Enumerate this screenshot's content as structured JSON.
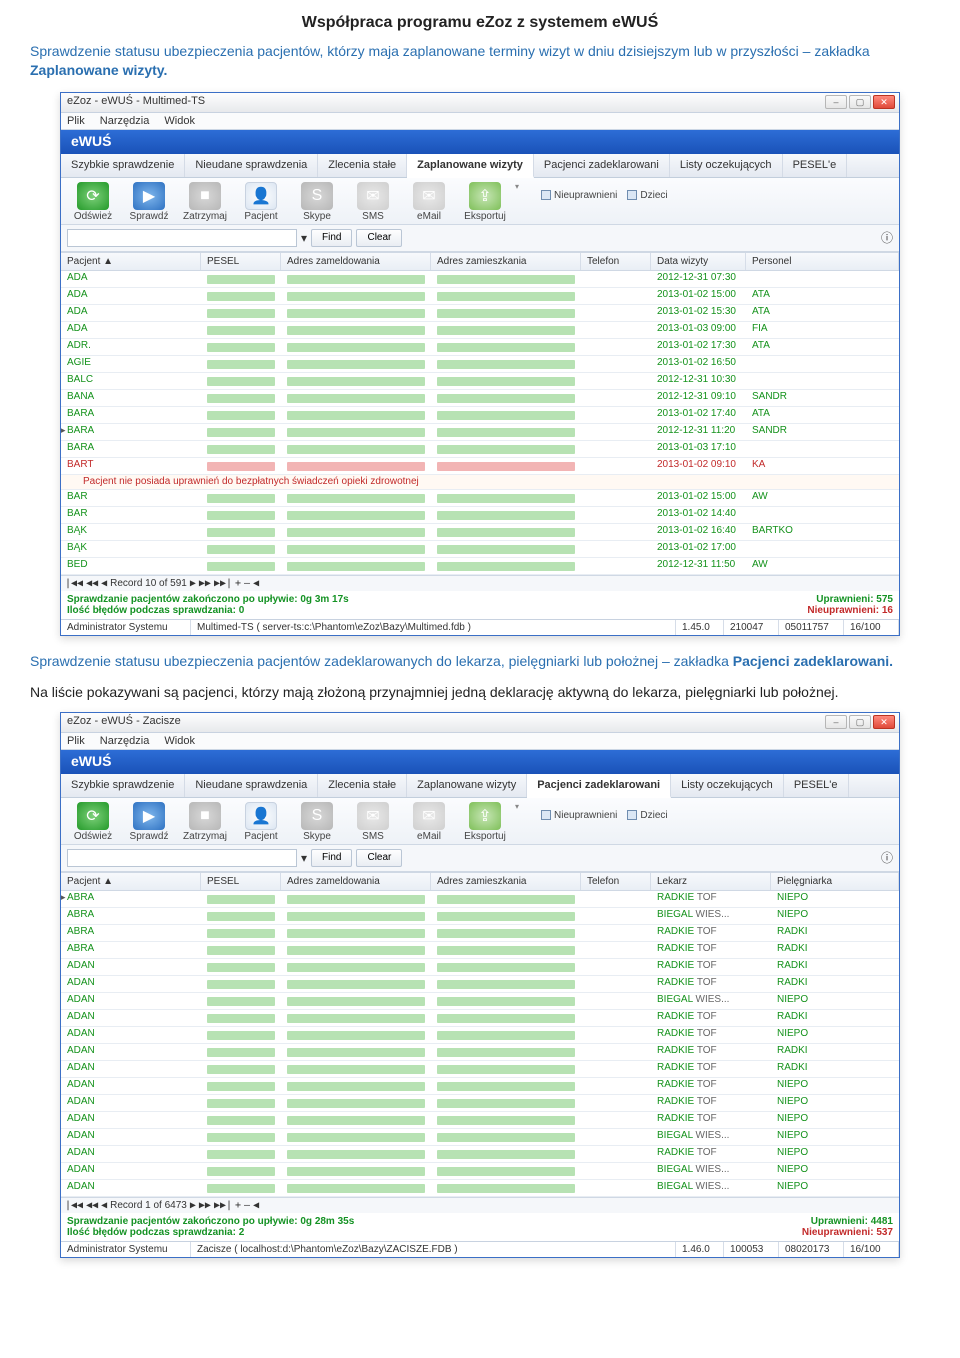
{
  "page_title": "Współpraca programu eZoz z systemem eWUŚ",
  "intro1_a": "Sprawdzenie statusu ubezpieczenia pacjentów, którzy maja zaplanowane terminy wizyt w dniu dzisiejszym lub w przyszłości – zakładka ",
  "intro1_b": "Zaplanowane wizyty.",
  "intro2_a": "Sprawdzenie statusu ubezpieczenia pacjentów zadeklarowanych do lekarza, pielęgniarki lub położnej – zakładka ",
  "intro2_b": "Pacjenci zadeklarowani.",
  "body2": "Na liście pokazywani są pacjenci, którzy mają złożoną przynajmniej jedną deklarację aktywną do lekarza, pielęgniarki lub położnej.",
  "menus": {
    "plik": "Plik",
    "narzedzia": "Narzędzia",
    "widok": "Widok"
  },
  "win_ctrls": {
    "min": "–",
    "max": "▢",
    "close": "✕"
  },
  "band": "eWUŚ",
  "tabs": {
    "szybkie": "Szybkie sprawdzenie",
    "nieudane": "Nieudane sprawdzenia",
    "zlecenia": "Zlecenia stałe",
    "zaplanowane": "Zaplanowane wizyty",
    "zadeklarowani": "Pacjenci zadeklarowani",
    "listy": "Listy oczekujących",
    "pesel": "PESEL'e"
  },
  "tools": {
    "odswiez": "Odśwież",
    "sprawdz": "Sprawdź",
    "zatrzymaj": "Zatrzymaj",
    "pacjent": "Pacjent",
    "skype": "Skype",
    "sms": "SMS",
    "email": "eMail",
    "eksportuj": "Eksportuj"
  },
  "side": {
    "nieupr": "Nieuprawnieni",
    "dzieci": "Dzieci",
    "drop": "▾"
  },
  "filter": {
    "find": "Find",
    "clear": "Clear",
    "drop": "▾",
    "info": "ⓘ"
  },
  "winA": {
    "title": "eZoz - eWUŚ - Multimed-TS",
    "headers": {
      "pacjent": "Pacjent",
      "pesel": "PESEL",
      "adrm": "Adres zameldowania",
      "adrz": "Adres zamieszkania",
      "tel": "Telefon",
      "data": "Data wizyty",
      "pers": "Personel",
      "sort": "▲"
    },
    "warn": "Pacjent nie posiada uprawnień do bezpłatnych świadczeń opieki zdrowotnej",
    "rows": [
      {
        "n": "ADA",
        "d": "2012-12-31 07:30",
        "p": "",
        "s": "g"
      },
      {
        "n": "ADA",
        "d": "2013-01-02 15:00",
        "p": "ATA",
        "s": "g"
      },
      {
        "n": "ADA",
        "d": "2013-01-02 15:30",
        "p": "ATA",
        "s": "g"
      },
      {
        "n": "ADA",
        "d": "2013-01-03 09:00",
        "p": "FIA",
        "s": "g"
      },
      {
        "n": "ADR.",
        "d": "2013-01-02 17:30",
        "p": "ATA",
        "s": "g"
      },
      {
        "n": "AGIE",
        "d": "2013-01-02 16:50",
        "p": "",
        "s": "g"
      },
      {
        "n": "BALC",
        "d": "2012-12-31 10:30",
        "p": "",
        "s": "g"
      },
      {
        "n": "BANA",
        "d": "2012-12-31 09:10",
        "p": "SANDR",
        "s": "g"
      },
      {
        "n": "BARA",
        "d": "2013-01-02 17:40",
        "p": "ATA",
        "s": "g"
      },
      {
        "n": "BARA",
        "d": "2012-12-31 11:20",
        "p": "SANDR",
        "s": "g",
        "sel": true
      },
      {
        "n": "BARA",
        "d": "2013-01-03 17:10",
        "p": "",
        "s": "g"
      },
      {
        "n": "BART",
        "d": "2013-01-02 09:10",
        "p": "KA",
        "s": "r",
        "warn": true
      },
      {
        "n": "BAR",
        "d": "2013-01-02 15:00",
        "p": "AW",
        "s": "g"
      },
      {
        "n": "BAR",
        "d": "2013-01-02 14:40",
        "p": "",
        "s": "g"
      },
      {
        "n": "BĄK",
        "d": "2013-01-02 16:40",
        "p": "BARTKO",
        "s": "g"
      },
      {
        "n": "BĄK",
        "d": "2013-01-02 17:00",
        "p": "",
        "s": "g"
      },
      {
        "n": "BED",
        "d": "2012-12-31 11:50",
        "p": "AW",
        "s": "g"
      }
    ],
    "pager": {
      "first": "|◀◀",
      "prev2": "◀◀",
      "prev": "◀",
      "rec": "Record 10 of 591",
      "next": "▶",
      "next2": "▶▶",
      "last": "▶▶|",
      "add": "+",
      "del": "–",
      "edit": "◀"
    },
    "stats": {
      "ok": "Sprawdzanie pacjentów zakończono po upływie: 0g 3m 17s",
      "err": "Ilość błędów podczas sprawdzania: 0",
      "up": "Uprawnieni: 575",
      "nup": "Nieuprawnieni: 16"
    },
    "status": {
      "admin": "Administrator Systemu",
      "db": "Multimed-TS ( server-ts:c:\\Phantom\\eZoz\\Bazy\\Multimed.fdb )",
      "ver": "1.45.0",
      "a": "210047",
      "b": "05011757",
      "c": "16/100"
    }
  },
  "winB": {
    "title": "eZoz - eWUŚ - Zacisze",
    "headers": {
      "pacjent": "Pacjent",
      "pesel": "PESEL",
      "adrm": "Adres zameldowania",
      "adrz": "Adres zamieszkania",
      "tel": "Telefon",
      "lek": "Lekarz",
      "piel": "Pielęgniarka",
      "sort": "▲"
    },
    "rows": [
      {
        "n": "ABRA",
        "l": "RADKIE",
        "lp": "TOF",
        "p": "NIEPO",
        "s": "g",
        "sel": true
      },
      {
        "n": "ABRA",
        "l": "BIEGAL",
        "lp": "WIES...",
        "p": "NIEPO",
        "s": "g"
      },
      {
        "n": "ABRA",
        "l": "RADKIE",
        "lp": "TOF",
        "p": "RADKI",
        "s": "g"
      },
      {
        "n": "ABRA",
        "l": "RADKIE",
        "lp": "TOF",
        "p": "RADKI",
        "s": "g"
      },
      {
        "n": "ADAN",
        "l": "RADKIE",
        "lp": "TOF",
        "p": "RADKI",
        "s": "g"
      },
      {
        "n": "ADAN",
        "l": "RADKIE",
        "lp": "TOF",
        "p": "RADKI",
        "s": "g"
      },
      {
        "n": "ADAN",
        "l": "BIEGAL",
        "lp": "WIES...",
        "p": "NIEPO",
        "s": "g"
      },
      {
        "n": "ADAN",
        "l": "RADKIE",
        "lp": "TOF",
        "p": "RADKI",
        "s": "g"
      },
      {
        "n": "ADAN",
        "l": "RADKIE",
        "lp": "TOF",
        "p": "NIEPO",
        "s": "g"
      },
      {
        "n": "ADAN",
        "l": "RADKIE",
        "lp": "TOF",
        "p": "RADKI",
        "s": "g"
      },
      {
        "n": "ADAN",
        "l": "RADKIE",
        "lp": "TOF",
        "p": "RADKI",
        "s": "g"
      },
      {
        "n": "ADAN",
        "l": "RADKIE",
        "lp": "TOF",
        "p": "NIEPO",
        "s": "g"
      },
      {
        "n": "ADAN",
        "l": "RADKIE",
        "lp": "TOF",
        "p": "NIEPO",
        "s": "g"
      },
      {
        "n": "ADAN",
        "l": "RADKIE",
        "lp": "TOF",
        "p": "NIEPO",
        "s": "g"
      },
      {
        "n": "ADAN",
        "l": "BIEGAL",
        "lp": "WIES...",
        "p": "NIEPO",
        "s": "g"
      },
      {
        "n": "ADAN",
        "l": "RADKIE",
        "lp": "TOF",
        "p": "NIEPO",
        "s": "g"
      },
      {
        "n": "ADAN",
        "l": "BIEGAL",
        "lp": "WIES...",
        "p": "NIEPO",
        "s": "g"
      },
      {
        "n": "ADAN",
        "l": "BIEGAL",
        "lp": "WIES...",
        "p": "NIEPO",
        "s": "g"
      }
    ],
    "pager": {
      "first": "|◀◀",
      "prev2": "◀◀",
      "prev": "◀",
      "rec": "Record 1 of 6473",
      "next": "▶",
      "next2": "▶▶",
      "last": "▶▶|",
      "add": "+",
      "del": "–",
      "edit": "◀"
    },
    "stats": {
      "ok": "Sprawdzanie pacjentów zakończono po upływie: 0g 28m 35s",
      "err": "Ilość błędów podczas sprawdzania: 2",
      "up": "Uprawnieni: 4481",
      "nup": "Nieuprawnieni: 537"
    },
    "status": {
      "admin": "Administrator Systemu",
      "db": "Zacisze ( localhost:d:\\Phantom\\eZoz\\Bazy\\ZACISZE.FDB )",
      "ver": "1.46.0",
      "a": "100053",
      "b": "08020173",
      "c": "16/100"
    }
  }
}
